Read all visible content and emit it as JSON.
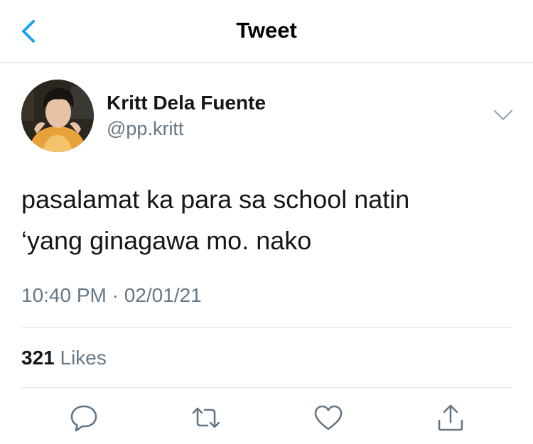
{
  "header": {
    "title": "Tweet",
    "back_icon": "chevron-left-icon",
    "accent": "#1da1f2"
  },
  "tweet": {
    "author": {
      "name": "Kritt Dela Fuente",
      "handle": "@pp.kritt"
    },
    "text_lines": [
      "pasalamat ka para sa school natin",
      "‘yang ginagawa mo. nako"
    ],
    "time": "10:40 PM",
    "separator": "·",
    "date": "02/01/21",
    "likes": {
      "count": "321",
      "label": "Likes"
    }
  },
  "actions": [
    "reply-icon",
    "retweet-icon",
    "like-icon",
    "share-icon"
  ],
  "colors": {
    "text": "#14171a",
    "secondary": "#657786",
    "accent": "#1da1f2",
    "divider": "#e1e1e1"
  }
}
